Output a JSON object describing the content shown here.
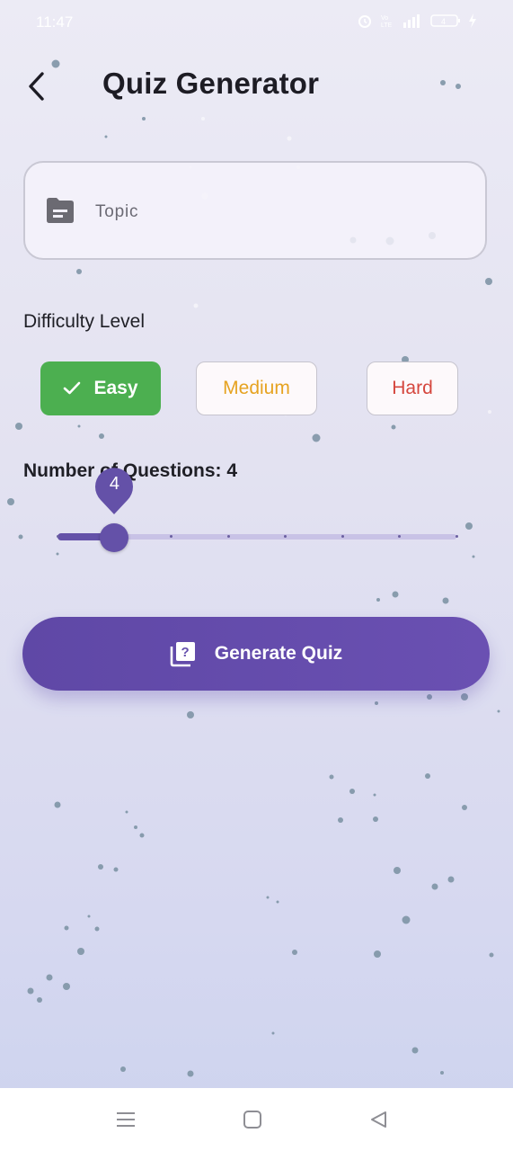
{
  "status_bar": {
    "time": "11:47",
    "battery": "4"
  },
  "header": {
    "title": "Quiz Generator",
    "back_icon": "chevron-left-icon"
  },
  "topic": {
    "placeholder": "Topic",
    "value": "",
    "icon": "folder-icon"
  },
  "difficulty": {
    "label": "Difficulty Level",
    "options": [
      {
        "label": "Easy",
        "selected": true,
        "color": "#4caf50"
      },
      {
        "label": "Medium",
        "selected": false,
        "color": "#e6a321"
      },
      {
        "label": "Hard",
        "selected": false,
        "color": "#d5473e"
      }
    ]
  },
  "questions": {
    "label": "Number of Questions: 4",
    "value": 4,
    "value_label": "4",
    "min": 3,
    "max": 10,
    "accent": "#6451a8"
  },
  "generate": {
    "label": "Generate Quiz",
    "icon": "quiz-icon"
  },
  "nav": {
    "items": [
      "menu-icon",
      "home-icon",
      "back-icon"
    ]
  }
}
